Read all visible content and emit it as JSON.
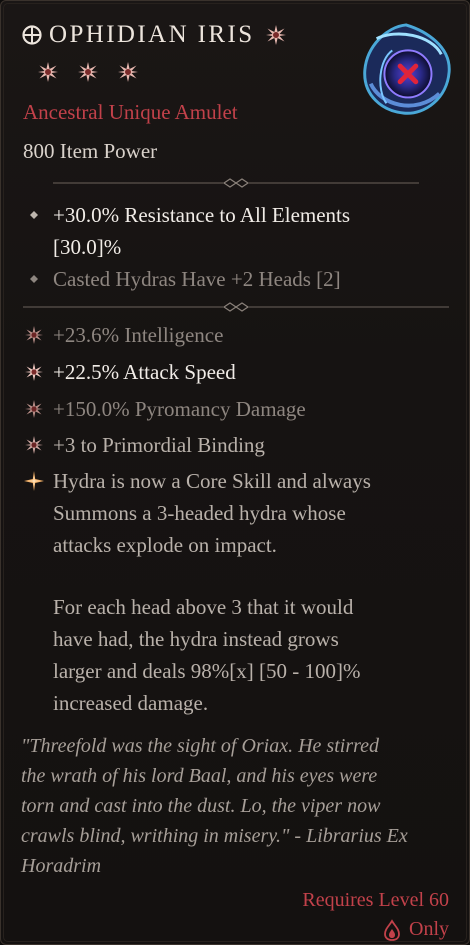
{
  "item": {
    "name": "OPHIDIAN IRIS",
    "type": "Ancestral Unique Amulet",
    "item_power": "800 Item Power"
  },
  "implicit": [
    {
      "line1": "+30.0% Resistance to All Elements",
      "line2": "[30.0]%"
    },
    {
      "line1": "Casted Hydras Have +2 Heads [2]"
    }
  ],
  "affixes": [
    {
      "text": "+23.6% Intelligence"
    },
    {
      "text": "+22.5% Attack Speed"
    },
    {
      "text": "+150.0% Pyromancy Damage"
    },
    {
      "text": "+3 to Primordial Binding"
    }
  ],
  "unique_power": {
    "lines": [
      "Hydra is now a Core Skill and always",
      "Summons a 3-headed hydra whose",
      "attacks explode on impact.",
      "",
      "For each head above 3 that it would",
      "have had, the hydra instead grows",
      "larger and deals 98%[x] [50 - 100]%",
      "increased damage."
    ]
  },
  "flavor": {
    "lines": [
      "\"Threefold was the sight of Oriax. He stirred",
      "the wrath of his lord Baal, and his eyes were",
      "torn and cast into the dust. Lo, the viper now",
      "crawls blind, writhing in misery.\" - Librarius Ex",
      "Horadrim"
    ]
  },
  "requirements": {
    "level": "Requires Level 60",
    "class_only": "Only",
    "class_icon": "sorcerer-class-icon"
  },
  "colors": {
    "title": "#ece4dc",
    "unique_red": "#c2414a",
    "affix_star": "#e8b8b0",
    "unique_star": "#f0a860"
  }
}
